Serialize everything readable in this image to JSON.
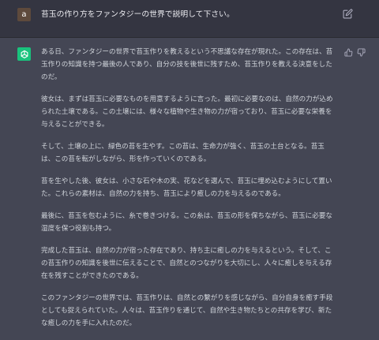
{
  "colors": {
    "user_bg": "#343541",
    "assistant_bg": "#444654",
    "user_avatar": "#5e4a3c",
    "bot_avatar": "#19c37d",
    "text": "#d1d5db",
    "icon": "#acacbe"
  },
  "user_message": {
    "avatar_letter": "a",
    "text": "苔玉の作り方をファンタジーの世界で説明して下さい。",
    "edit_icon": "edit-icon"
  },
  "assistant_message": {
    "avatar_icon": "chatgpt-logo-icon",
    "feedback": [
      "thumbs-up-icon",
      "thumbs-down-icon"
    ],
    "paragraphs": [
      "ある日、ファンタジーの世界で苔玉作りを教えるという不思議な存在が現れた。この存在は、苔玉作りの知識を持つ最後の人であり、自分の技を後世に残すため、苔玉作りを教える決意をしたのだ。",
      "彼女は、まずは苔玉に必要なものを用意するように言った。最初に必要なのは、自然の力が込められた土壌である。この土壌には、様々な植物や生き物の力が宿っており、苔玉に必要な栄養を与えることができる。",
      "そして、土壌の上に、緑色の苔を生やす。この苔は、生命力が強く、苔玉の土台となる。苔玉は、この苔を転がしながら、形を作っていくのである。",
      "苔を生やした後、彼女は、小さな石や木の実、花などを選んで、苔玉に埋め込むようにして置いた。これらの素材は、自然の力を持ち、苔玉により癒しの力を与えるのである。",
      "最後に、苔玉を包むように、糸で巻きつける。この糸は、苔玉の形を保ちながら、苔玉に必要な湿度を保つ役割も持つ。",
      "完成した苔玉は、自然の力が宿った存在であり、持ち主に癒しの力を与えるという。そして、この苔玉作りの知識を後世に伝えることで、自然とのつながりを大切にし、人々に癒しを与える存在を残すことができたのである。",
      "このファンタジーの世界では、苔玉作りは、自然との繋がりを感じながら、自分自身を癒す手段としても捉えられていた。人々は、苔玉作りを通じて、自然や生き物たちとの共存を学び、新たな癒しの力を手に入れたのだ。"
    ]
  }
}
